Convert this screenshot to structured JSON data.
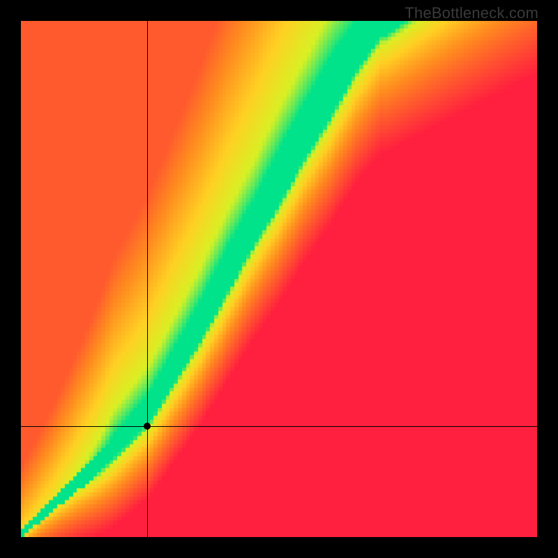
{
  "watermark": "TheBottleneck.com",
  "chart_data": {
    "type": "heatmap",
    "title": "",
    "xlabel": "",
    "ylabel": "",
    "xlim": [
      0,
      1
    ],
    "ylim": [
      0,
      1
    ],
    "grid": false,
    "legend": null,
    "crosshair": {
      "x": 0.245,
      "y": 0.215
    },
    "marker": {
      "x": 0.245,
      "y": 0.215
    },
    "optimal_band": {
      "description": "Green optimal region (lowest bottleneck) as a narrow band; each entry gives x and the y-range spanned by the green band. The band is narrower at low x and widens at higher x. Values are read off the rendered chart and are approximate to ~0.01.",
      "points": [
        {
          "x": 0.0,
          "y_low": 0.0,
          "y_high": 0.01
        },
        {
          "x": 0.05,
          "y_low": 0.04,
          "y_high": 0.06
        },
        {
          "x": 0.1,
          "y_low": 0.08,
          "y_high": 0.11
        },
        {
          "x": 0.15,
          "y_low": 0.12,
          "y_high": 0.16
        },
        {
          "x": 0.2,
          "y_low": 0.17,
          "y_high": 0.22
        },
        {
          "x": 0.25,
          "y_low": 0.22,
          "y_high": 0.28
        },
        {
          "x": 0.3,
          "y_low": 0.3,
          "y_high": 0.37
        },
        {
          "x": 0.35,
          "y_low": 0.38,
          "y_high": 0.46
        },
        {
          "x": 0.4,
          "y_low": 0.47,
          "y_high": 0.56
        },
        {
          "x": 0.45,
          "y_low": 0.56,
          "y_high": 0.65
        },
        {
          "x": 0.5,
          "y_low": 0.64,
          "y_high": 0.75
        },
        {
          "x": 0.55,
          "y_low": 0.73,
          "y_high": 0.84
        },
        {
          "x": 0.6,
          "y_low": 0.81,
          "y_high": 0.93
        },
        {
          "x": 0.65,
          "y_low": 0.9,
          "y_high": 1.0
        },
        {
          "x": 0.7,
          "y_low": 0.97,
          "y_high": 1.0
        }
      ]
    },
    "field_description": "Scalar field ~ |y - f(x)| mapped red→yellow→green (low = green). f is near-linear then steeper, producing a diagonal green ridge from bottom-left toward top-center. Far from the ridge the field relaxes toward yellow/orange in the upper-right and toward red in the lower-right and left regions.",
    "pixelation": 128,
    "colors": {
      "low": "#00e38a",
      "mid_lo": "#d8f024",
      "mid": "#ffd023",
      "mid_hi": "#ff8a1f",
      "high": "#ff1f3f"
    }
  }
}
